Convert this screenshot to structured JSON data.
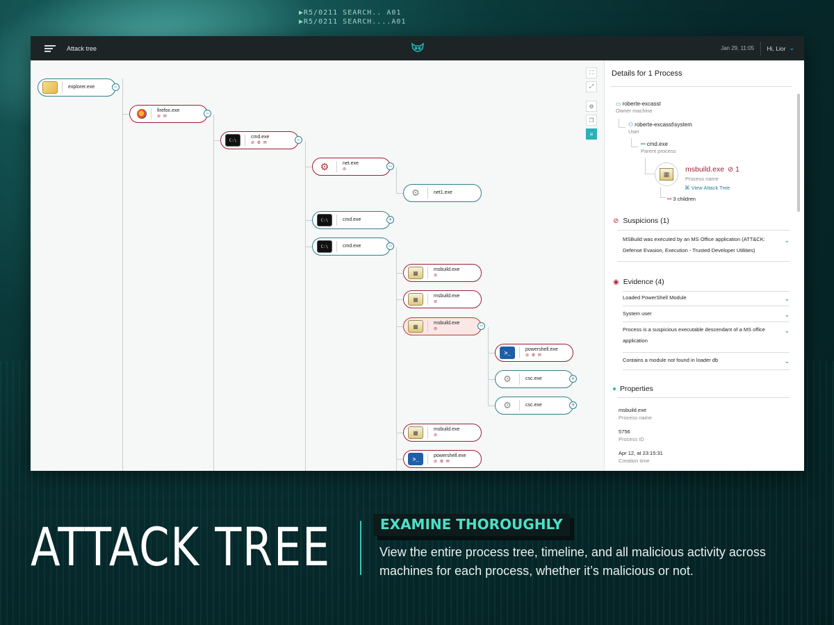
{
  "background": {
    "code_lines": [
      "▶R5/0211 SEARCH.. A01",
      "▶R5/0211 SEARCH....A01"
    ]
  },
  "app": {
    "title": "Attack tree",
    "datetime": "Jan 29, 11:05",
    "user": "Hi, Lior",
    "accent": "#2bb0b6",
    "malicious_color": "#9b1d33"
  },
  "tree": {
    "nodes": [
      {
        "name": "explorer.exe",
        "icon": "folder-icon",
        "badges": ""
      },
      {
        "name": "firefox.exe",
        "icon": "firefox-icon",
        "badges": "⊘ ✉"
      },
      {
        "name": "cmd.exe",
        "icon": "cmd-icon",
        "badges": "⊘ ⚙ ✉"
      },
      {
        "name": "net.exe",
        "icon": "gear-icon",
        "badges": "⊘"
      },
      {
        "name": "net1.exe",
        "icon": "gear-icon",
        "badges": ""
      },
      {
        "name": "cmd.exe",
        "icon": "cmd-icon",
        "badges": ""
      },
      {
        "name": "cmd.exe",
        "icon": "cmd-icon",
        "badges": ""
      },
      {
        "name": "msbuild.exe",
        "icon": "msbuild-icon",
        "badges": "⊘"
      },
      {
        "name": "msbuild.exe",
        "icon": "msbuild-icon",
        "badges": "⊘"
      },
      {
        "name": "msbuild.exe",
        "icon": "msbuild-icon",
        "badges": "⊘"
      },
      {
        "name": "powershell.exe",
        "icon": "powershell-icon",
        "badges": "⊘ ⚙ ✉"
      },
      {
        "name": "csc.exe",
        "icon": "gear-icon",
        "badges": ""
      },
      {
        "name": "csc.exe",
        "icon": "gear-icon",
        "badges": ""
      },
      {
        "name": "msbuild.exe",
        "icon": "msbuild-icon",
        "badges": "⊘"
      },
      {
        "name": "powershell.exe",
        "icon": "powershell-icon",
        "badges": "⊘ ⚙ ✉"
      }
    ]
  },
  "details": {
    "title": "Details for 1 Process",
    "owner_machine": "roberte-excasst",
    "owner_machine_label": "Owner machine",
    "user": "roberte-excasst\\system",
    "user_label": "User",
    "parent": "cmd.exe",
    "parent_label": "Parent process",
    "process_name": "msbuild.exe",
    "process_count": "1",
    "process_name_label": "Process name",
    "view_attack_tree": "View Attack Tree",
    "children": "3 children",
    "suspicions_title": "Suspicions (1)",
    "suspicions": [
      "MSBuild was executed by an MS Office application (ATT&CK: Defense Evasion, Execution - Trusted Developer Utilities)"
    ],
    "evidence_title": "Evidence (4)",
    "evidence": [
      "Loaded PowerShell Module",
      "System user",
      "Process is a suspicious executable descendant of a MS office application",
      "Contains a module not found in loader db"
    ],
    "properties_title": "Properties",
    "properties": [
      {
        "value": "msbuild.exe",
        "label": "Process name"
      },
      {
        "value": "5756",
        "label": "Process ID"
      },
      {
        "value": "Apr 12, at 23:15:31",
        "label": "Creation time"
      }
    ]
  },
  "marketing": {
    "headline": "ATTACK TREE",
    "tagline": "EXAMINE THOROUGHLY",
    "description": "View the entire process tree, timeline, and all malicious activity across machines for each process, whether it’s malicious or not."
  }
}
